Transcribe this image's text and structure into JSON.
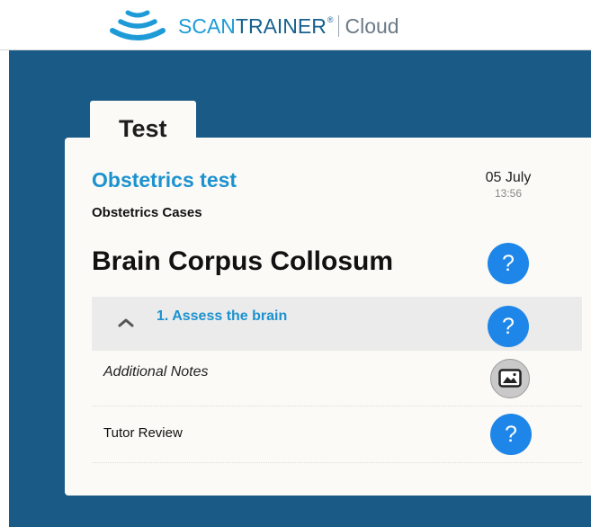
{
  "header": {
    "brand_scan": "SCAN",
    "brand_trainer": "TRAINER",
    "brand_reg": "®",
    "brand_product": "Cloud"
  },
  "tab": {
    "label": "Test"
  },
  "test": {
    "title": "Obstetrics test",
    "subtitle": "Obstetrics Cases",
    "date": "05 July",
    "time": "13:56"
  },
  "case": {
    "title": "Brain Corpus Collosum",
    "help_symbol": "?"
  },
  "step": {
    "label": "1. Assess the brain",
    "help_symbol": "?",
    "chevron_icon": "chevron-up-icon"
  },
  "notes": {
    "label": "Additional Notes",
    "icon": "image-icon"
  },
  "tutor": {
    "label": "Tutor Review",
    "help_symbol": "?"
  },
  "colors": {
    "brand_dark": "#17628f",
    "brand_light": "#1e9bd7",
    "stage_background": "#1a5a87",
    "card_background": "#fbfaf6",
    "accent_text": "#1c92cf",
    "help_button": "#1e86e8"
  }
}
